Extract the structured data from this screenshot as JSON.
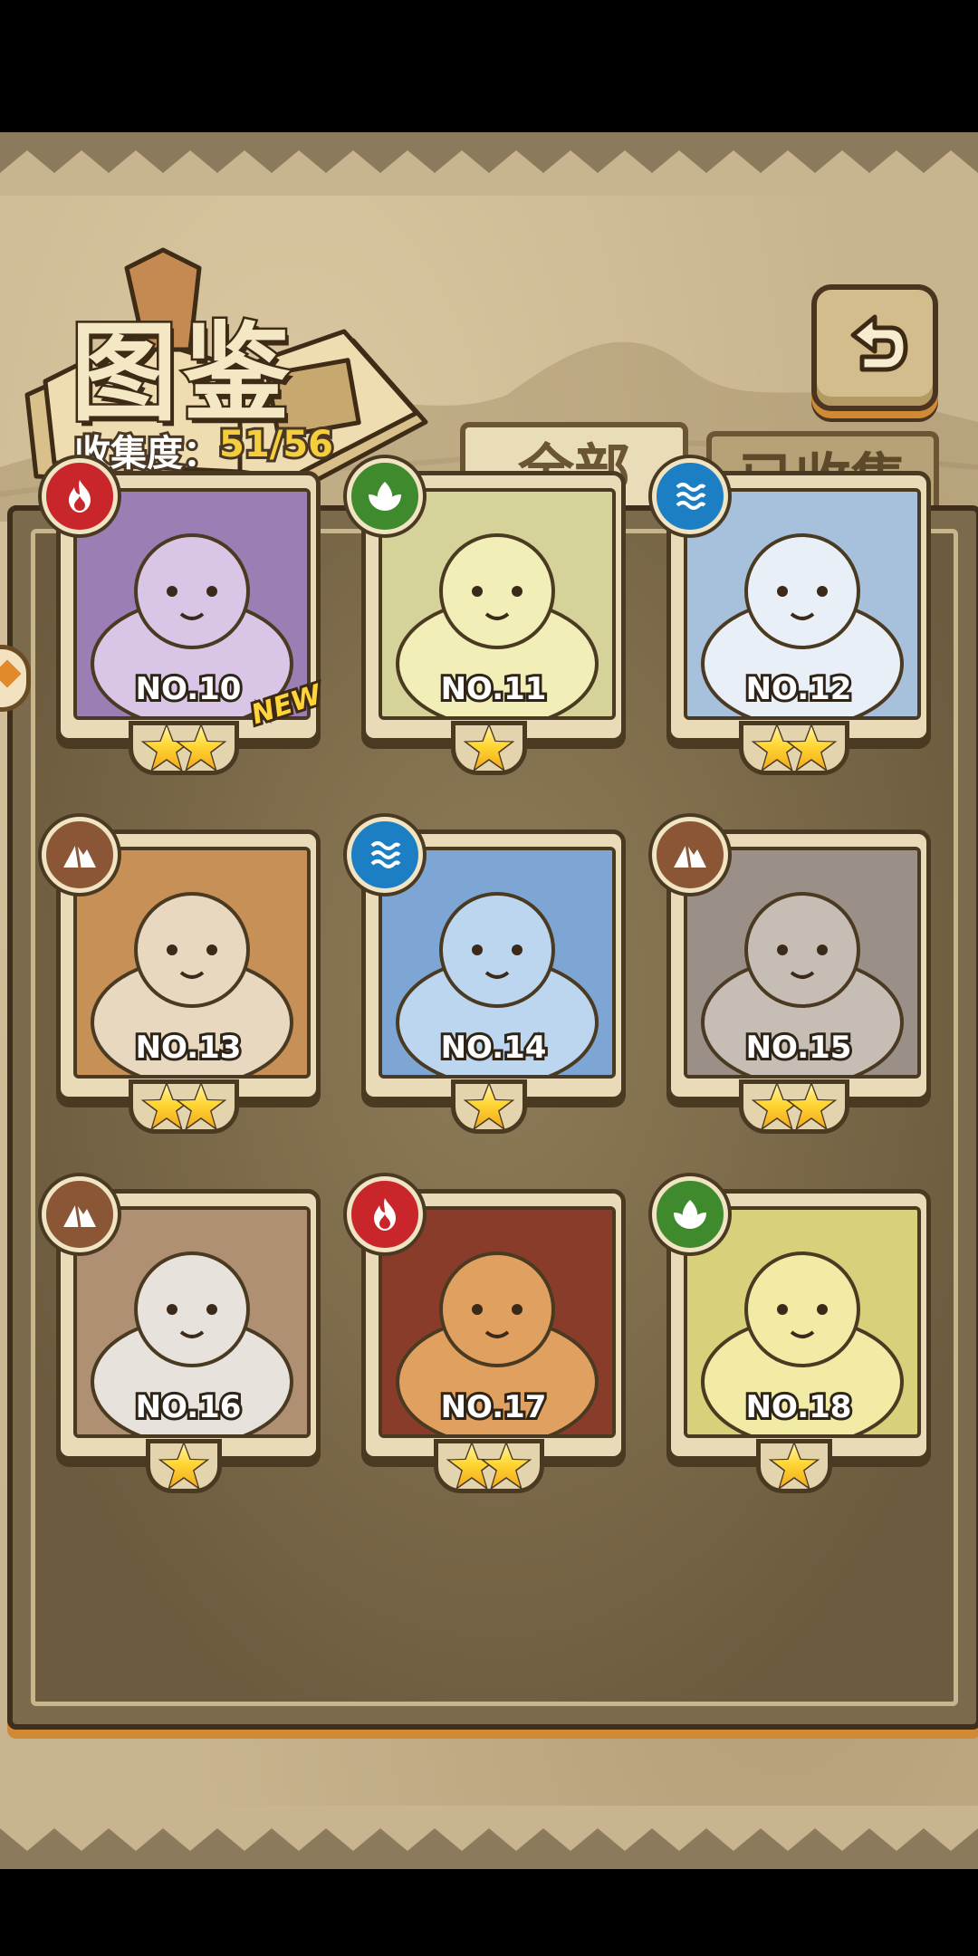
{
  "header": {
    "title": "图鉴",
    "collect_label": "收集度：",
    "collect_value": "51/56"
  },
  "tabs": [
    {
      "label": "全部",
      "active": true
    },
    {
      "label": "已收集",
      "active": false
    }
  ],
  "colors": {
    "fire": "#c9262b",
    "grass": "#3f8a2c",
    "water": "#1c7fc4",
    "earth": "#8a5636",
    "star": "#ffd633",
    "accent": "#d08a35"
  },
  "cards": [
    {
      "number": "NO.10",
      "stars": 2,
      "element": "fire",
      "new": true,
      "new_label": "NEW"
    },
    {
      "number": "NO.11",
      "stars": 1,
      "element": "grass",
      "new": false
    },
    {
      "number": "NO.12",
      "stars": 2,
      "element": "water",
      "new": false
    },
    {
      "number": "NO.13",
      "stars": 2,
      "element": "earth",
      "new": false
    },
    {
      "number": "NO.14",
      "stars": 1,
      "element": "water",
      "new": false
    },
    {
      "number": "NO.15",
      "stars": 2,
      "element": "earth",
      "new": false
    },
    {
      "number": "NO.16",
      "stars": 1,
      "element": "earth",
      "new": false
    },
    {
      "number": "NO.17",
      "stars": 2,
      "element": "fire",
      "new": false
    },
    {
      "number": "NO.18",
      "stars": 1,
      "element": "grass",
      "new": false
    }
  ]
}
